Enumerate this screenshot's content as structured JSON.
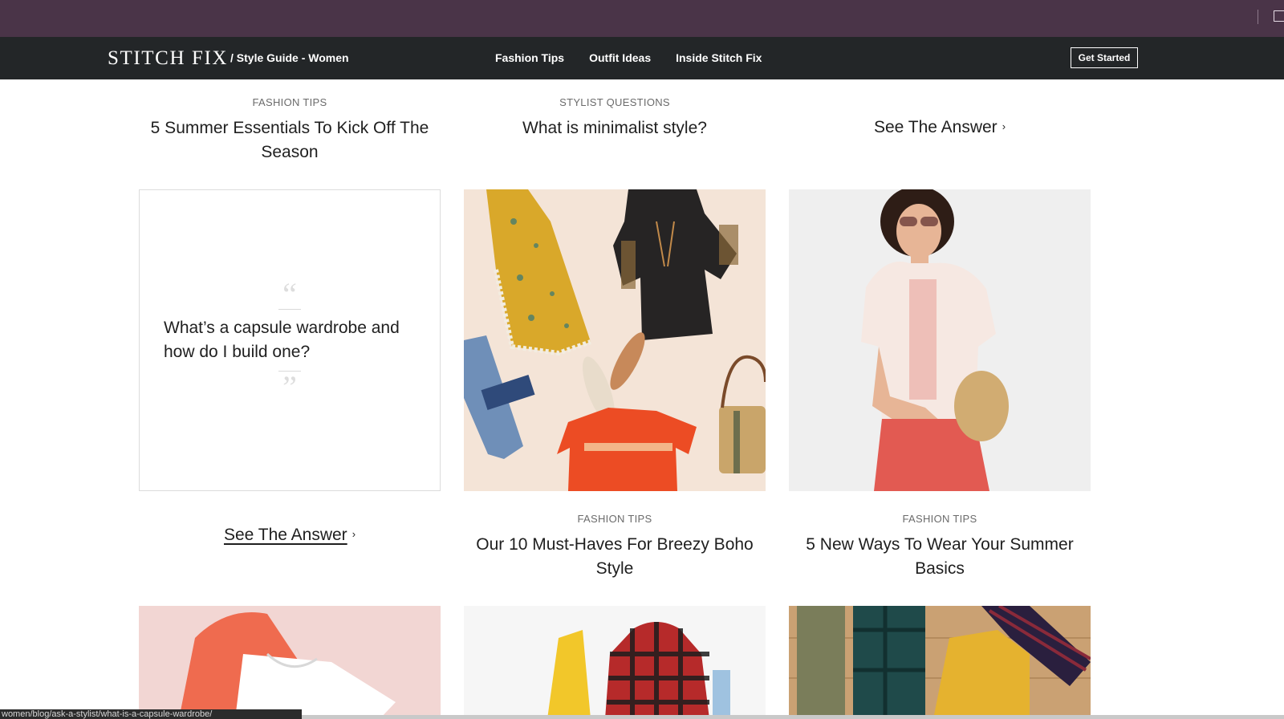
{
  "header": {
    "logo": "STITCH FIX",
    "section": "/ Style Guide - Women",
    "nav": [
      "Fashion Tips",
      "Outfit Ideas",
      "Inside Stitch Fix"
    ],
    "cta": "Get Started"
  },
  "row1": [
    {
      "eyebrow": "FASHION TIPS",
      "title": "5 Summer Essentials To Kick Off The Season"
    },
    {
      "eyebrow": "STYLIST QUESTIONS",
      "title": "What is minimalist style?"
    },
    {
      "link": "See The Answer",
      "chevron": "›"
    }
  ],
  "quote_card": {
    "open_quote": "“",
    "text": "What’s a capsule wardrobe and how do I build one?",
    "close_quote": "”"
  },
  "row2": [
    {
      "link": "See The Answer",
      "chevron": "›"
    },
    {
      "eyebrow": "FASHION TIPS",
      "title": "Our 10 Must-Haves For Breezy Boho Style"
    },
    {
      "eyebrow": "FASHION TIPS",
      "title": "5 New Ways To Wear Your Summer Basics"
    }
  ],
  "status_bar": {
    "url": "women/blog/ask-a-stylist/what-is-a-capsule-wardrobe/"
  },
  "colors": {
    "chrome": "#4a3448",
    "nav": "#232628",
    "boho_bg": "#f4e4d7",
    "portrait_bg": "#efefef",
    "pink_bg": "#f2d6d3"
  }
}
